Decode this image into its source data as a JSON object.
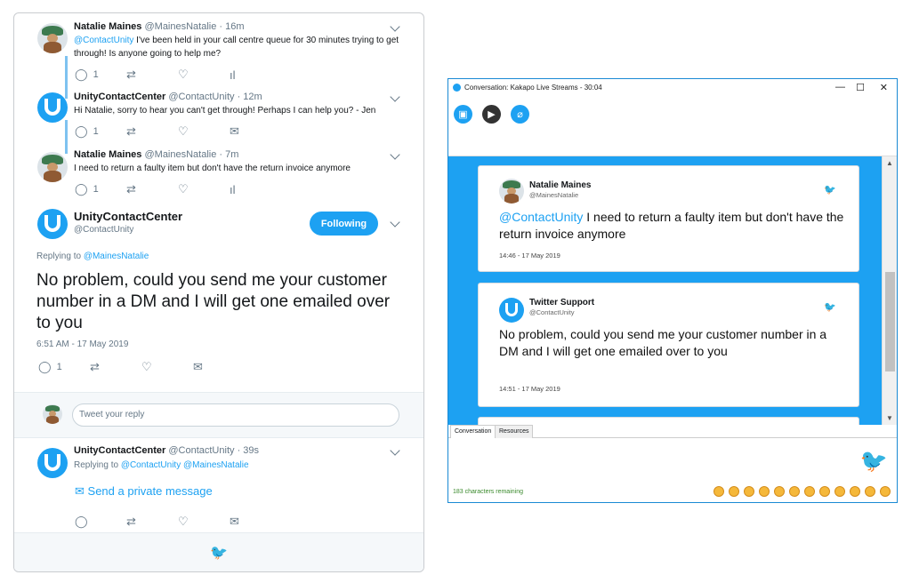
{
  "twitter": {
    "tweets": [
      {
        "name": "Natalie Maines",
        "handle": "@MainesNatalie",
        "time": "16m",
        "mention": "@ContactUnity",
        "text": " I've been held in your call centre queue for 30 minutes trying to get through! Is anyone going to help me?",
        "reply_count": "1"
      },
      {
        "name": "UnityContactCenter",
        "handle": "@ContactUnity",
        "time": "12m",
        "text": "Hi Natalie, sorry to hear you can't get through! Perhaps I can help you? - Jen",
        "reply_count": "1"
      },
      {
        "name": "Natalie Maines",
        "handle": "@MainesNatalie",
        "time": "7m",
        "text": "I need to return a faulty item but don't have the return invoice anymore",
        "reply_count": "1"
      }
    ],
    "main": {
      "name": "UnityContactCenter",
      "handle": "@ContactUnity",
      "follow_label": "Following",
      "replying_prefix": "Replying to",
      "replying_to": "@MainesNatalie",
      "text": "No problem, could you send me your customer number in a DM and I will get one emailed over to you",
      "timestamp": "6:51 AM - 17 May 2019",
      "reply_count": "1"
    },
    "reply_placeholder": "Tweet your reply",
    "bottom_tweet": {
      "name": "UnityContactCenter",
      "handle": "@ContactUnity",
      "time": "39s",
      "replying_prefix": "Replying to",
      "replying_to": "@ContactUnity @MainesNatalie",
      "dm_label": "Send a private message"
    }
  },
  "window": {
    "title": "Conversation: Kakapo Live Streams - 30:04",
    "cards": [
      {
        "name": "Natalie Maines",
        "handle": "@MainesNatalie",
        "mention": "@ContactUnity",
        "text": " I need to return a faulty item but don't have the return invoice anymore",
        "time": "14:46 - 17 May 2019"
      },
      {
        "name": "Twitter Support",
        "handle": "@ContactUnity",
        "text": "No problem, could you send me your customer number in a DM and I will get one emailed over to you",
        "time": "14:51 - 17 May 2019"
      }
    ],
    "tabs": [
      "Conversation",
      "Resources"
    ],
    "chars_remaining": "183 characters remaining"
  },
  "colors": {
    "twitter_blue": "#1da1f2",
    "window_border": "#1a8ad4",
    "remaining_green": "#3a8a2c"
  }
}
